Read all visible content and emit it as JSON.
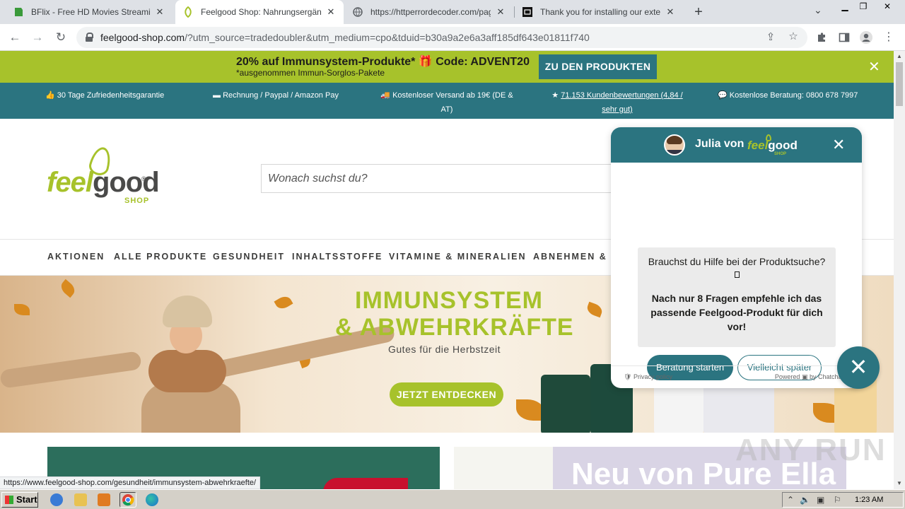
{
  "browser": {
    "tabs": [
      {
        "title": "BFlix - Free HD Movies Streaming - Watch",
        "favicon": "bflix-favicon",
        "active": false
      },
      {
        "title": "Feelgood Shop: Nahrungsergänzungsmittel",
        "favicon": "feelgood-favicon",
        "active": true
      },
      {
        "title": "https://httperrordecoder.com/page/",
        "favicon": "globe-icon",
        "active": false
      },
      {
        "title": "Thank you for installing our extension",
        "favicon": "extension-favicon",
        "active": false
      }
    ],
    "url_host": "feelgood-shop.com",
    "url_rest": "/?utm_source=tradedoubler&utm_medium=cpo&tduid=b30a9a2e6a3aff185df643e01811f740"
  },
  "promo": {
    "headline": "20% auf Immunsystem-Produkte* 🎁 Code: ADVENT20",
    "subline": "*ausgenommen Immun-Sorglos-Pakete",
    "cta": "ZU DEN PRODUKTEN"
  },
  "usp": [
    {
      "icon": "thumbs-up-icon",
      "text": "30 Tage Zufriedenheitsgarantie"
    },
    {
      "icon": "credit-card-icon",
      "text": "Rechnung / Paypal / Amazon Pay"
    },
    {
      "icon": "truck-icon",
      "text": "Kostenloser Versand ab 19€ (DE &",
      "text2": "AT)"
    },
    {
      "icon": "star-icon",
      "text": "71.153 Kundenbewertungen (4,84 /",
      "text2": "sehr gut)"
    },
    {
      "icon": "chat-icon",
      "text": "Kostenlose Beratung: 0800 678 7997"
    }
  ],
  "logo": {
    "feel": "feel",
    "good": "good",
    "shop": "SHOP",
    "reg": "®"
  },
  "search": {
    "placeholder": "Wonach suchst du?"
  },
  "nav": [
    "AKTIONEN",
    "ALLE PRODUKTE",
    "GESUNDHEIT",
    "INHALTSSTOFFE",
    "VITAMINE & MINERALIEN",
    "ABNEHMEN & F"
  ],
  "hero": {
    "line1": "IMMUNSYSTEM",
    "line2": "& ABWEHRKRÄFTE",
    "tagline": "Gutes für die Herbstzeit",
    "cta": "JETZT ENTDECKEN"
  },
  "tiles": {
    "pure_ella": "Neu von Pure Ella"
  },
  "status_url": "https://www.feelgood-shop.com/gesundheit/immunsystem-abwehrkraefte/",
  "chat": {
    "agent": "Julia von",
    "logo_feel": "feel",
    "logo_good": "good",
    "logo_shop": "SHOP",
    "message1": "Brauchst du Hilfe bei der Produktsuche?",
    "message2": "Nach nur 8 Fragen empfehle ich das passende Feelgood-Produkt für dich vor!",
    "primary": "Beratung starten",
    "secondary": "Vielleicht später",
    "privacy": "Privacy policy",
    "powered": "Powered",
    "by": "by Chatchamp"
  },
  "watermark": "ANY RUN",
  "taskbar": {
    "start": "Start",
    "clock": "1:23 AM"
  },
  "colors": {
    "brand_green": "#a7c22b",
    "brand_teal": "#2b7480"
  }
}
